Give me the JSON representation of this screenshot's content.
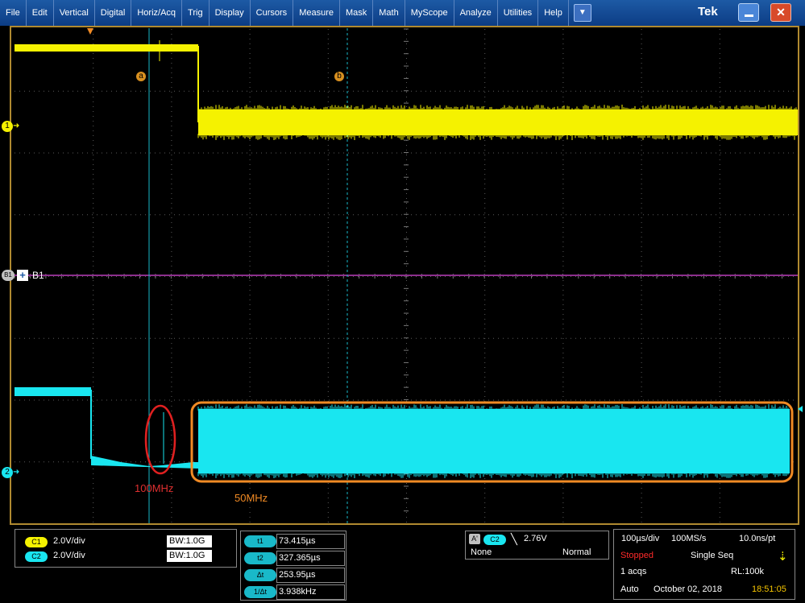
{
  "menu": {
    "items": [
      "File",
      "Edit",
      "Vertical",
      "Digital",
      "Horiz/Acq",
      "Trig",
      "Display",
      "Cursors",
      "Measure",
      "Mask",
      "Math",
      "MyScope",
      "Analyze",
      "Utilities",
      "Help"
    ],
    "dropdown_icon": "chevron-down-icon",
    "brand": "Tek",
    "minimize_icon": "minimize-icon",
    "close_icon": "close-icon"
  },
  "scope": {
    "ch1_marker": "1",
    "ch2_marker": "2",
    "bus_marker": "B1",
    "bus_label": "B1",
    "bus_plus": "+",
    "cursor_a": "a",
    "cursor_b": "b",
    "annotation_left": "100MHz",
    "annotation_right": "50MHz",
    "colors": {
      "ch1": "#f5f200",
      "ch2": "#19e6f0",
      "bus": "#8c2f8c",
      "grid": "#5a5a5a",
      "annot_red": "#e02020",
      "annot_orange": "#f08a24",
      "frame": "#b08a30"
    }
  },
  "channels": [
    {
      "chip": "C1",
      "scale": "2.0V/div",
      "bw": "BW:1.0G",
      "color": "#f5f200"
    },
    {
      "chip": "C2",
      "scale": "2.0V/div",
      "bw": "BW:1.0G",
      "color": "#19e6f0"
    }
  ],
  "cursors": [
    {
      "chip": "t1",
      "value": "73.415µs"
    },
    {
      "chip": "t2",
      "value": "327.365µs"
    },
    {
      "chip": "Δt",
      "value": "253.95µs"
    },
    {
      "chip": "1/Δt",
      "value": "3.938kHz"
    }
  ],
  "trigger": {
    "a_chip": "A'",
    "src_chip": "C2",
    "slope_icon": "falling-edge-icon",
    "level": "2.76V",
    "coupling": "None",
    "mode": "Normal"
  },
  "acquisition": {
    "timebase": "100µs/div",
    "sample_rate": "100MS/s",
    "resolution": "10.0ns/pt",
    "state": "Stopped",
    "seq": "Single Seq",
    "acqs": "1 acqs",
    "record_length": "RL:100k",
    "mode": "Auto",
    "date": "October 02, 2018",
    "time": "18:51:05",
    "trigger_icon": "trigger-indicator-icon"
  }
}
